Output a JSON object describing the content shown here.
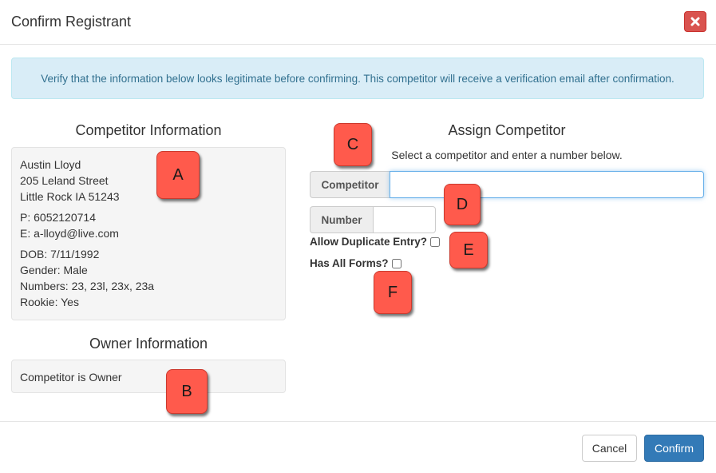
{
  "modal": {
    "title": "Confirm Registrant",
    "close_icon": "close-icon"
  },
  "alert": {
    "text": "Verify that the information below looks legitimate before confirming. This competitor will receive a verification email after confirmation."
  },
  "competitor_info": {
    "title": "Competitor Information",
    "name": "Austin Lloyd",
    "street": "205 Leland Street",
    "city": "Little Rock IA 51243",
    "phone": "P: 6052120714",
    "email": "E: a-lloyd@live.com",
    "dob": "DOB: 7/11/1992",
    "gender": "Gender: Male",
    "numbers": "Numbers: 23, 23l, 23x, 23a",
    "rookie": "Rookie: Yes"
  },
  "owner_info": {
    "title": "Owner Information",
    "text": "Competitor is Owner"
  },
  "assign": {
    "title": "Assign Competitor",
    "hint": "Select a competitor and enter a number below.",
    "competitor_label": "Competitor",
    "competitor_value": "",
    "number_label": "Number",
    "number_value": "",
    "allow_duplicate_label": "Allow Duplicate Entry?",
    "allow_duplicate_checked": false,
    "has_all_forms_label": "Has All Forms?",
    "has_all_forms_checked": false
  },
  "markers": {
    "a": "A",
    "b": "B",
    "c": "C",
    "d": "D",
    "e": "E",
    "f": "F",
    "color": "#ff5a4c"
  },
  "footer": {
    "cancel_label": "Cancel",
    "confirm_label": "Confirm"
  },
  "colors": {
    "danger": "#d9534f",
    "primary": "#337ab7",
    "info_bg": "#d9edf7",
    "info_text": "#31708f"
  }
}
